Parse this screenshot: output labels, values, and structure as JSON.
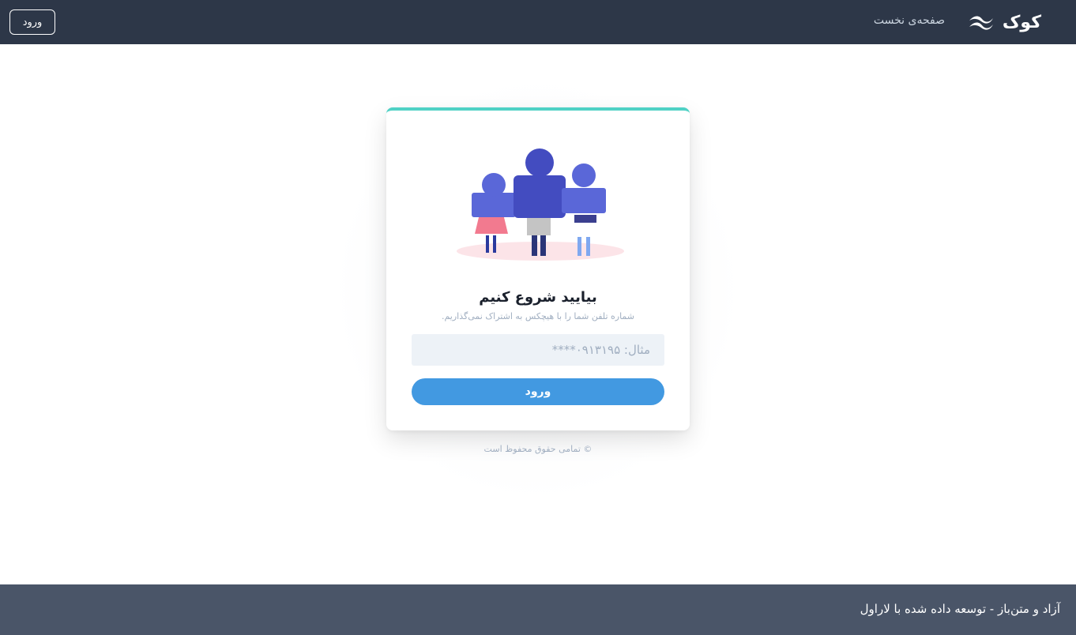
{
  "header": {
    "brand_name": "کوک",
    "brand_icon": "wave-logo-icon",
    "nav_home": "صفحه‌ی نخست",
    "login_label": "ورود"
  },
  "card": {
    "illustration": "people-group-illustration",
    "title": "بیایید شروع کنیم",
    "subtitle": "شماره تلفن شما را با هیچکس به اشتراک نمی‌گذاریم.",
    "phone_placeholder": "مثال: ۰۹۱۳۱۹۵****",
    "phone_value": "",
    "submit_label": "ورود"
  },
  "copyright": "© تمامی حقوق محفوظ است",
  "footer": {
    "text": "آزاد و متن‌باز - توسعه داده شده با لاراول"
  },
  "colors": {
    "header_bg": "#2d3748",
    "footer_bg": "#4a5568",
    "accent_teal": "#4fd1c5",
    "button_blue": "#4299e1",
    "input_bg": "#edf2f7",
    "illustration_purple": "#5a67d8"
  }
}
